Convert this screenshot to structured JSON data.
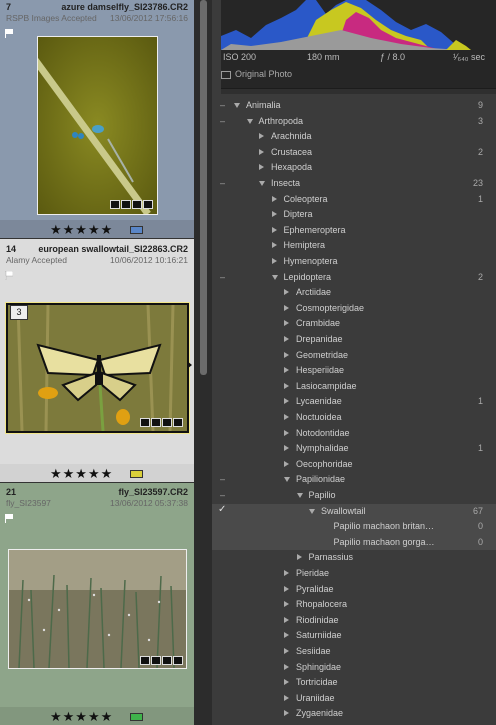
{
  "grid": {
    "cells": [
      {
        "index": "7",
        "filename": "azure damselfly_SI23786.CR2",
        "metadata": "RSPB Images Accepted",
        "date": "13/06/2012 17:56:16",
        "stars": "★★★★★",
        "label_color": "#5a86c7",
        "bg": "#8a99ad"
      },
      {
        "index": "14",
        "filename": "european swallowtail_SI22863.CR2",
        "metadata": "Alamy Accepted",
        "date": "10/06/2012 10:16:21",
        "stars": "★★★★★",
        "label_color": "#d9cf3a",
        "bg": "#dcdcdc",
        "stack_count": "3"
      },
      {
        "index": "21",
        "filename": "fly_SI23597.CR2",
        "metadata": "fly_SI23597",
        "date": "13/06/2012 05:37:38",
        "stars": "★★★★★",
        "label_color": "#3fb34b",
        "bg": "#8ea58a"
      }
    ]
  },
  "histogram": {
    "iso": "ISO 200",
    "focal": "180 mm",
    "aperture": "ƒ / 8.0",
    "shutter": "¹⁄₆₄₀ sec",
    "original_photo_label": "Original Photo"
  },
  "keywords": [
    {
      "name": "Animalia",
      "level": 1,
      "state": "open",
      "count": "9",
      "minus": true
    },
    {
      "name": "Arthropoda",
      "level": 2,
      "state": "open",
      "count": "3",
      "minus": true
    },
    {
      "name": "Arachnida",
      "level": 3,
      "state": "closed",
      "count": ""
    },
    {
      "name": "Crustacea",
      "level": 3,
      "state": "closed",
      "count": "2"
    },
    {
      "name": "Hexapoda",
      "level": 3,
      "state": "closed",
      "count": ""
    },
    {
      "name": "Insecta",
      "level": 3,
      "state": "open",
      "count": "23",
      "minus": true
    },
    {
      "name": "Coleoptera",
      "level": 4,
      "state": "closed",
      "count": "1"
    },
    {
      "name": "Diptera",
      "level": 4,
      "state": "closed",
      "count": ""
    },
    {
      "name": "Ephemeroptera",
      "level": 4,
      "state": "closed",
      "count": ""
    },
    {
      "name": "Hemiptera",
      "level": 4,
      "state": "closed",
      "count": ""
    },
    {
      "name": "Hymenoptera",
      "level": 4,
      "state": "closed",
      "count": ""
    },
    {
      "name": "Lepidoptera",
      "level": 4,
      "state": "open",
      "count": "2",
      "minus": true
    },
    {
      "name": "Arctiidae",
      "level": 5,
      "state": "closed",
      "count": ""
    },
    {
      "name": "Cosmopterigidae",
      "level": 5,
      "state": "closed",
      "count": ""
    },
    {
      "name": "Crambidae",
      "level": 5,
      "state": "closed",
      "count": ""
    },
    {
      "name": "Drepanidae",
      "level": 5,
      "state": "closed",
      "count": ""
    },
    {
      "name": "Geometridae",
      "level": 5,
      "state": "closed",
      "count": ""
    },
    {
      "name": "Hesperiidae",
      "level": 5,
      "state": "closed",
      "count": ""
    },
    {
      "name": "Lasiocampidae",
      "level": 5,
      "state": "closed",
      "count": ""
    },
    {
      "name": "Lycaenidae",
      "level": 5,
      "state": "closed",
      "count": "1"
    },
    {
      "name": "Noctuoidea",
      "level": 5,
      "state": "closed",
      "count": ""
    },
    {
      "name": "Notodontidae",
      "level": 5,
      "state": "closed",
      "count": ""
    },
    {
      "name": "Nymphalidae",
      "level": 5,
      "state": "closed",
      "count": "1"
    },
    {
      "name": "Oecophoridae",
      "level": 5,
      "state": "closed",
      "count": ""
    },
    {
      "name": "Papilionidae",
      "level": 5,
      "state": "open",
      "count": "",
      "minus": true
    },
    {
      "name": "Papilio",
      "level": 6,
      "state": "open",
      "count": "",
      "minus": true
    },
    {
      "name": "Swallowtail",
      "level": 7,
      "state": "open",
      "count": "67",
      "check": true,
      "selected": true
    },
    {
      "name": "Papilio machaon britan…",
      "level": 8,
      "state": "none",
      "count": "0",
      "selected": true
    },
    {
      "name": "Papilio machaon gorga…",
      "level": 8,
      "state": "none",
      "count": "0",
      "selected": true
    },
    {
      "name": "Parnassius",
      "level": 6,
      "state": "closed",
      "count": ""
    },
    {
      "name": "Pieridae",
      "level": 5,
      "state": "closed",
      "count": ""
    },
    {
      "name": "Pyralidae",
      "level": 5,
      "state": "closed",
      "count": ""
    },
    {
      "name": "Rhopalocera",
      "level": 5,
      "state": "closed",
      "count": ""
    },
    {
      "name": "Riodinidae",
      "level": 5,
      "state": "closed",
      "count": ""
    },
    {
      "name": "Saturniidae",
      "level": 5,
      "state": "closed",
      "count": ""
    },
    {
      "name": "Sesiidae",
      "level": 5,
      "state": "closed",
      "count": ""
    },
    {
      "name": "Sphingidae",
      "level": 5,
      "state": "closed",
      "count": ""
    },
    {
      "name": "Tortricidae",
      "level": 5,
      "state": "closed",
      "count": ""
    },
    {
      "name": "Uraniidae",
      "level": 5,
      "state": "closed",
      "count": ""
    },
    {
      "name": "Zygaenidae",
      "level": 5,
      "state": "closed",
      "count": ""
    }
  ]
}
